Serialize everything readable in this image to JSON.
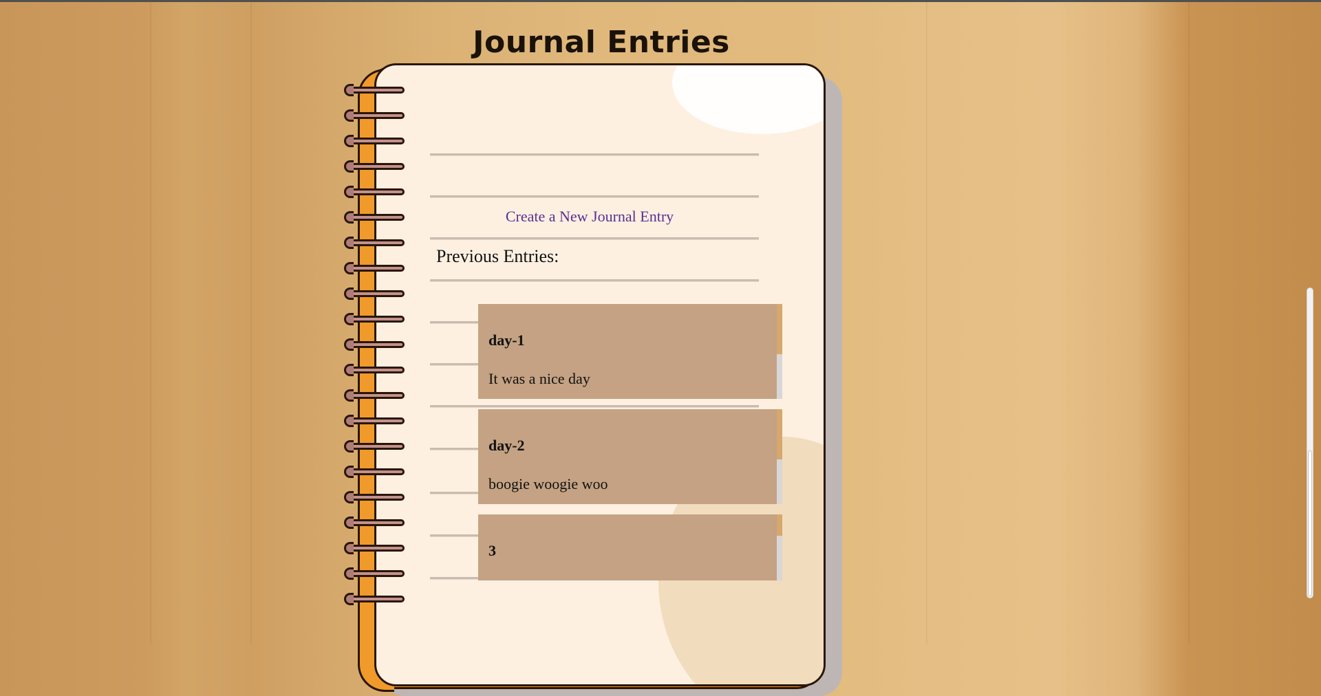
{
  "page": {
    "title": "Journal Entries"
  },
  "actions": {
    "create_link_label": "Create a New Journal Entry"
  },
  "entries_section": {
    "heading": "Previous Entries:",
    "entries": [
      {
        "title": "day-1",
        "body": "It was a nice day"
      },
      {
        "title": "day-2",
        "body": "boogie woogie woo"
      },
      {
        "title": "3",
        "body": ""
      }
    ]
  },
  "icons": {
    "notebook": "spiral-notebook-illustration"
  },
  "colors": {
    "link": "#5a2f91",
    "card": "#c4a283",
    "notebook_accent": "#f7941d",
    "page": "#fdf0e1"
  }
}
